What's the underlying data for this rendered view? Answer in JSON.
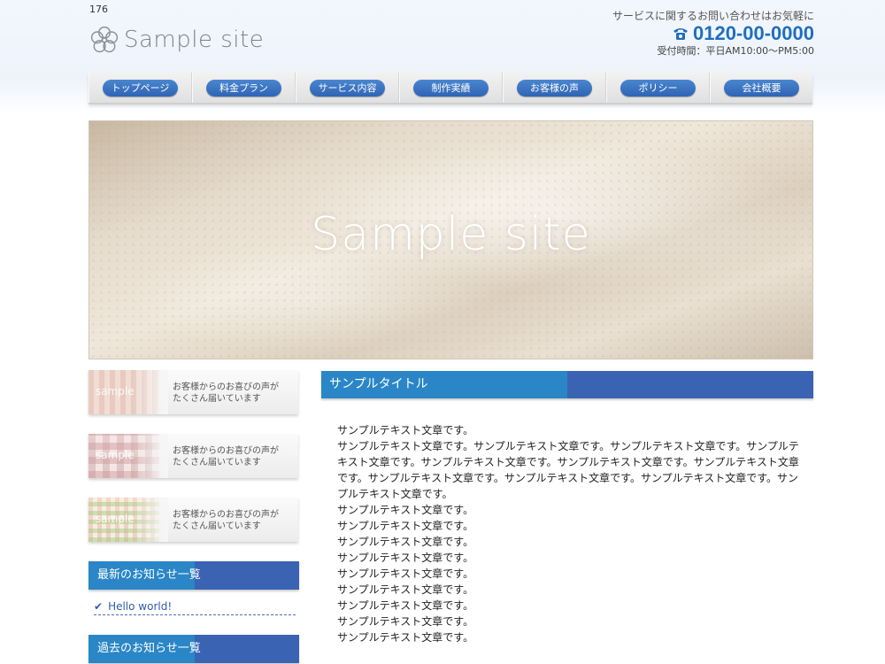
{
  "page_id": "176",
  "header": {
    "logo_text": "Sample site",
    "contact_lead": "サービスに関するお問い合わせはお気軽に",
    "phone": "0120-00-0000",
    "hours": "受付時間：平日AM10:00〜PM5:00"
  },
  "nav": {
    "items": [
      {
        "label": "トップページ"
      },
      {
        "label": "料金プラン"
      },
      {
        "label": "サービス内容"
      },
      {
        "label": "制作実績"
      },
      {
        "label": "お客様の声"
      },
      {
        "label": "ポリシー"
      },
      {
        "label": "会社概要"
      }
    ]
  },
  "hero": {
    "title": "Sample site"
  },
  "sidebar": {
    "banners": [
      {
        "thumb_label": "sample",
        "text_line1": "お客様からのお喜びの声が",
        "text_line2": "たくさん届いています"
      },
      {
        "thumb_label": "sample",
        "text_line1": "お客様からのお喜びの声が",
        "text_line2": "たくさん届いています"
      },
      {
        "thumb_label": "sample",
        "text_line1": "お客様からのお喜びの声が",
        "text_line2": "たくさん届いています"
      }
    ],
    "news_heading": "最新のお知らせ一覧",
    "news_items": [
      {
        "label": "Hello world!"
      }
    ],
    "archive_heading": "過去のお知らせ一覧"
  },
  "main": {
    "title": "サンプルタイトル",
    "paragraphs": [
      "サンプルテキスト文章です。",
      "サンプルテキスト文章です。サンプルテキスト文章です。サンプルテキスト文章です。サンプルテキスト文章です。サンプルテキスト文章です。サンプルテキスト文章です。サンプルテキスト文章です。サンプルテキスト文章です。サンプルテキスト文章です。サンプルテキスト文章です。サンプルテキスト文章です。",
      "サンプルテキスト文章です。",
      "サンプルテキスト文章です。",
      "サンプルテキスト文章です。",
      "サンプルテキスト文章です。",
      "サンプルテキスト文章です。",
      "サンプルテキスト文章です。",
      "サンプルテキスト文章です。",
      "サンプルテキスト文章です。",
      "サンプルテキスト文章です。"
    ]
  },
  "colors": {
    "accent_blue": "#2a86c6",
    "accent_navy": "#3b63b3",
    "phone_blue": "#1e6fbf"
  }
}
